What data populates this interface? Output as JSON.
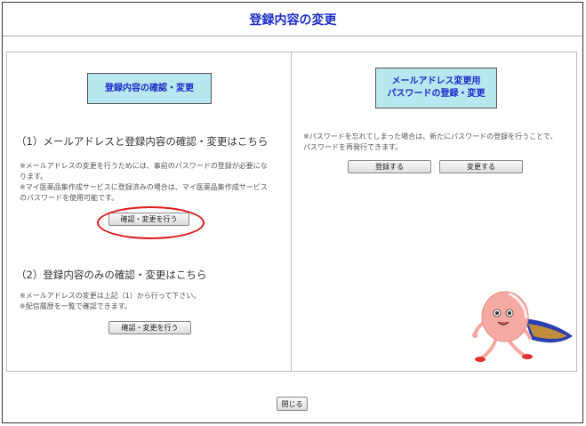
{
  "header": {
    "title": "登録内容の変更"
  },
  "left_panel": {
    "box_label": "登録内容の確認・変更",
    "section1": {
      "heading": "（1）メールアドレスと登録内容の確認・変更はこちら",
      "notes": [
        "※メールアドレスの変更を行うためには、事前のパスワードの登録が必要にな",
        "ります。",
        "※マイ医薬品集作成サービスに登録済みの場合は、マイ医薬品集作成サービス",
        "のパスワードを使用可能です。"
      ],
      "button_label": "確認・変更を行う"
    },
    "section2": {
      "heading": "（2）登録内容のみの確認・変更はこちら",
      "notes": [
        "※メールアドレスの変更は上記（1）から行って下さい。",
        "※配信履歴を一覧で確認できます。"
      ],
      "button_label": "確認・変更を行う"
    }
  },
  "right_panel": {
    "box_label_lines": [
      "メールアドレス変更用",
      "パスワードの登録・変更"
    ],
    "notes": [
      "※パスワードを忘れてしまった場合は、新たにパスワードの登録を行うことで、",
      "パスワードを再発行できます。"
    ],
    "register_button": "登録する",
    "change_button": "変更する"
  },
  "footer": {
    "close_button": "閉じる"
  },
  "colors": {
    "title": "#1a2ccc",
    "box_bg": "#b9e7ef",
    "highlight": "#e01515"
  },
  "mascot": {
    "icon": "pill-mascot-icon"
  }
}
